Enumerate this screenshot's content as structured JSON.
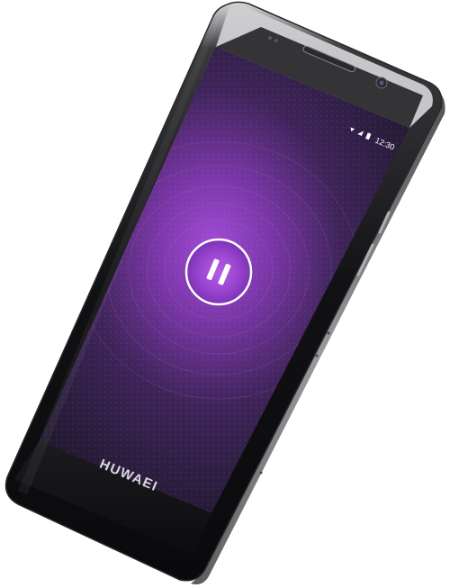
{
  "device": {
    "brand": "HUWAEI"
  },
  "status_bar": {
    "time": "12:30",
    "icons": [
      "wifi-icon",
      "signal-icon",
      "battery-icon"
    ]
  },
  "player": {
    "state": "paused",
    "control_icon": "pause-icon"
  },
  "colors": {
    "body": "#1a1a1d",
    "frame": "#7d7d80",
    "screen_glow": "#a24bd6",
    "screen_edge": "#20192e"
  }
}
